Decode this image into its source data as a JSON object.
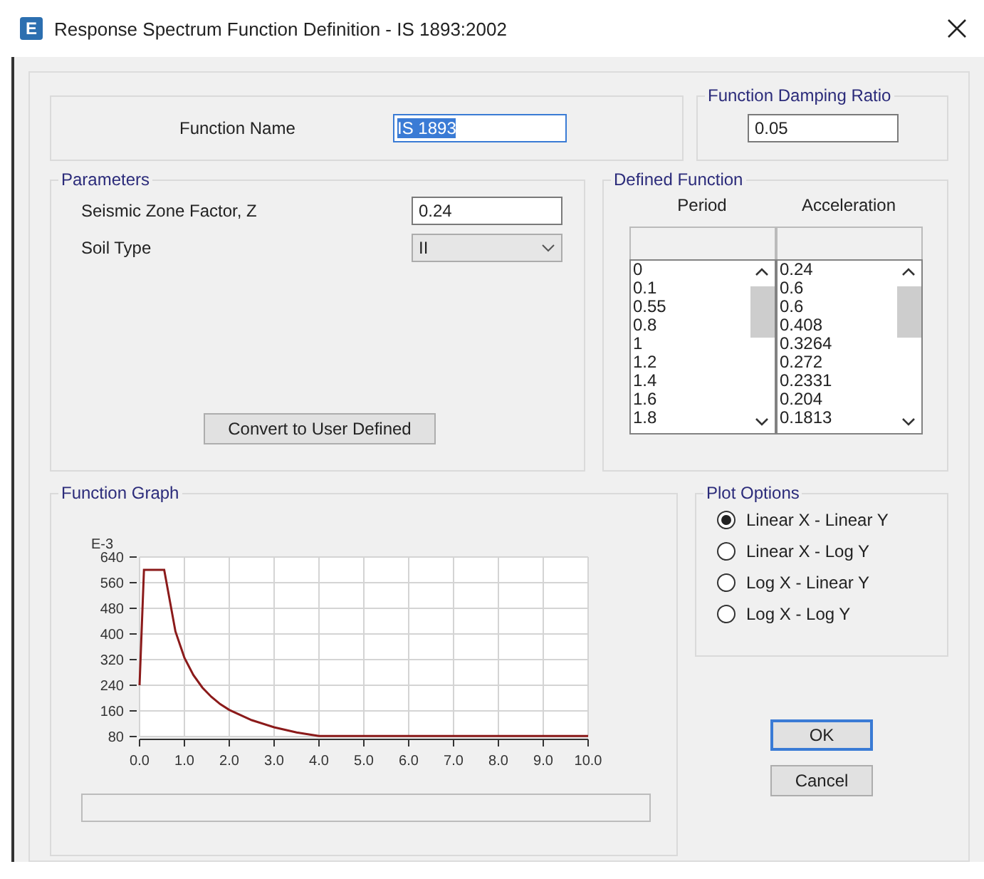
{
  "window": {
    "icon_letter": "E",
    "title": "Response Spectrum Function Definition - IS 1893:2002"
  },
  "function_name": {
    "label": "Function Name",
    "value": "IS 1893",
    "highlighted": true
  },
  "damping": {
    "title": "Function Damping Ratio",
    "value": "0.05"
  },
  "parameters": {
    "title": "Parameters",
    "fields": [
      {
        "kind": "text",
        "label": "Seismic Zone Factor, Z",
        "value": "0.24"
      },
      {
        "kind": "dropdown",
        "label": "Soil Type",
        "value": "II"
      }
    ],
    "convert_button": "Convert to User Defined"
  },
  "defined_function": {
    "title": "Defined Function",
    "columns": [
      {
        "heading": "Period",
        "values": [
          "0",
          "0.1",
          "0.55",
          "0.8",
          "1",
          "1.2",
          "1.4",
          "1.6",
          "1.8"
        ]
      },
      {
        "heading": "Acceleration",
        "values": [
          "0.24",
          "0.6",
          "0.6",
          "0.408",
          "0.3264",
          "0.272",
          "0.2331",
          "0.204",
          "0.1813"
        ]
      }
    ]
  },
  "function_graph": {
    "title": "Function Graph",
    "chart_data": {
      "type": "line",
      "ylabel": "E-3",
      "x": [
        0,
        0.1,
        0.55,
        0.8,
        1,
        1.2,
        1.4,
        1.6,
        1.8,
        2,
        2.5,
        3,
        3.5,
        4,
        10
      ],
      "series": [
        {
          "color": "#8b1a1a",
          "values": [
            240,
            600,
            600,
            408,
            326,
            272,
            233,
            204,
            181,
            163,
            131,
            109,
            93,
            82,
            82
          ]
        }
      ],
      "grid": true,
      "xlim": [
        0,
        10
      ],
      "ylim": [
        80,
        640
      ],
      "xticks": [
        {
          "value": 0,
          "label": "0.0"
        },
        {
          "value": 1,
          "label": "1.0"
        },
        {
          "value": 2,
          "label": "2.0"
        },
        {
          "value": 3,
          "label": "3.0"
        },
        {
          "value": 4,
          "label": "4.0"
        },
        {
          "value": 5,
          "label": "5.0"
        },
        {
          "value": 6,
          "label": "6.0"
        },
        {
          "value": 7,
          "label": "7.0"
        },
        {
          "value": 8,
          "label": "8.0"
        },
        {
          "value": 9,
          "label": "9.0"
        },
        {
          "value": 10,
          "label": "10.0"
        }
      ],
      "yticks": [
        80,
        160,
        240,
        320,
        400,
        480,
        560,
        640
      ]
    }
  },
  "plot_options": {
    "title": "Plot Options",
    "options": [
      {
        "label": "Linear X - Linear Y",
        "selected": true
      },
      {
        "label": "Linear X - Log Y",
        "selected": false
      },
      {
        "label": "Log X - Linear Y",
        "selected": false
      },
      {
        "label": "Log X - Log Y",
        "selected": false
      }
    ]
  },
  "buttons": [
    {
      "label": "OK",
      "default": true
    },
    {
      "label": "Cancel",
      "default": false
    }
  ]
}
